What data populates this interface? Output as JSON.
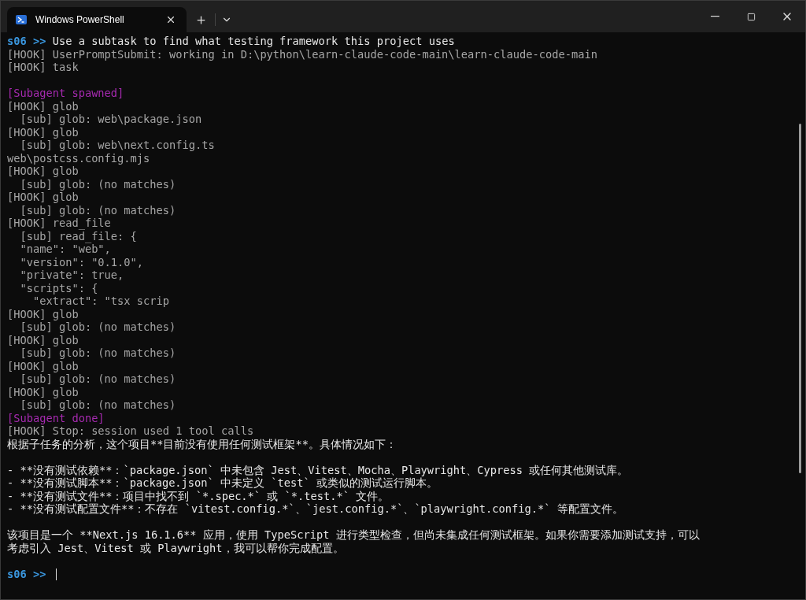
{
  "window": {
    "tab": {
      "title": "Windows PowerShell",
      "selected": true
    }
  },
  "terminal": {
    "lines": [
      {
        "kind": "prompt",
        "prompt": "s06 >>",
        "text": "Use a subtask to find what testing framework this project uses"
      },
      {
        "kind": "hook",
        "text": "[HOOK] UserPromptSubmit: working in D:\\python\\learn-claude-code-main\\learn-claude-code-main"
      },
      {
        "kind": "hook",
        "text": "[HOOK] task"
      },
      {
        "kind": "blank"
      },
      {
        "kind": "agent",
        "text": "[Subagent spawned]"
      },
      {
        "kind": "hook",
        "text": "[HOOK] glob"
      },
      {
        "kind": "hook",
        "text": "  [sub] glob: web\\package.json"
      },
      {
        "kind": "hook",
        "text": "[HOOK] glob"
      },
      {
        "kind": "hook",
        "text": "  [sub] glob: web\\next.config.ts"
      },
      {
        "kind": "hook",
        "text": "web\\postcss.config.mjs"
      },
      {
        "kind": "hook",
        "text": "[HOOK] glob"
      },
      {
        "kind": "hook",
        "text": "  [sub] glob: (no matches)"
      },
      {
        "kind": "hook",
        "text": "[HOOK] glob"
      },
      {
        "kind": "hook",
        "text": "  [sub] glob: (no matches)"
      },
      {
        "kind": "hook",
        "text": "[HOOK] read_file"
      },
      {
        "kind": "hook",
        "text": "  [sub] read_file: {"
      },
      {
        "kind": "hook",
        "text": "  \"name\": \"web\","
      },
      {
        "kind": "hook",
        "text": "  \"version\": \"0.1.0\","
      },
      {
        "kind": "hook",
        "text": "  \"private\": true,"
      },
      {
        "kind": "hook",
        "text": "  \"scripts\": {"
      },
      {
        "kind": "hook",
        "text": "    \"extract\": \"tsx scrip"
      },
      {
        "kind": "hook",
        "text": "[HOOK] glob"
      },
      {
        "kind": "hook",
        "text": "  [sub] glob: (no matches)"
      },
      {
        "kind": "hook",
        "text": "[HOOK] glob"
      },
      {
        "kind": "hook",
        "text": "  [sub] glob: (no matches)"
      },
      {
        "kind": "hook",
        "text": "[HOOK] glob"
      },
      {
        "kind": "hook",
        "text": "  [sub] glob: (no matches)"
      },
      {
        "kind": "hook",
        "text": "[HOOK] glob"
      },
      {
        "kind": "hook",
        "text": "  [sub] glob: (no matches)"
      },
      {
        "kind": "agent",
        "text": "[Subagent done]"
      },
      {
        "kind": "hook",
        "text": "[HOOK] Stop: session used 1 tool calls"
      },
      {
        "kind": "output",
        "text": "根据子任务的分析，这个项目**目前没有使用任何测试框架**。具体情况如下："
      },
      {
        "kind": "blank"
      },
      {
        "kind": "output",
        "text": "- **没有测试依赖**：`package.json` 中未包含 Jest、Vitest、Mocha、Playwright、Cypress 或任何其他测试库。"
      },
      {
        "kind": "output",
        "text": "- **没有测试脚本**：`package.json` 中未定义 `test` 或类似的测试运行脚本。"
      },
      {
        "kind": "output",
        "text": "- **没有测试文件**：项目中找不到 `*.spec.*` 或 `*.test.*` 文件。"
      },
      {
        "kind": "output",
        "text": "- **没有测试配置文件**：不存在 `vitest.config.*`、`jest.config.*`、`playwright.config.*` 等配置文件。"
      },
      {
        "kind": "blank"
      },
      {
        "kind": "output",
        "text": "该项目是一个 **Next.js 16.1.6** 应用，使用 TypeScript 进行类型检查，但尚未集成任何测试框架。如果你需要添加测试支持，可以"
      },
      {
        "kind": "output",
        "text": "考虑引入 Jest、Vitest 或 Playwright，我可以帮你完成配置。"
      },
      {
        "kind": "blank"
      },
      {
        "kind": "prompt",
        "prompt": "s06 >>",
        "cursor": true
      }
    ]
  }
}
